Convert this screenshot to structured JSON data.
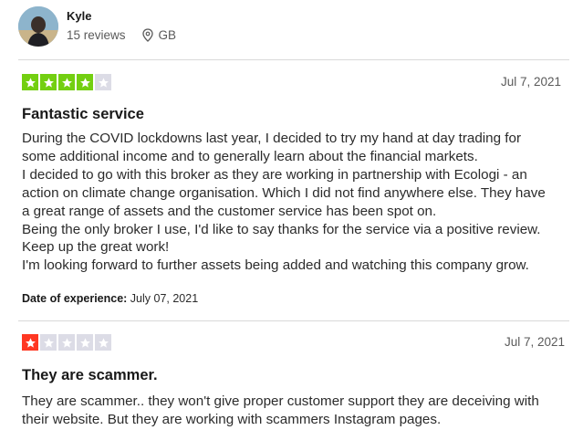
{
  "reviewer": {
    "name": "Kyle",
    "reviews_count": "15 reviews",
    "location": "GB"
  },
  "reviews": [
    {
      "rating": 4,
      "max_rating": 5,
      "star_color": "#73cf11",
      "empty_star_color": "#dcdce6",
      "date": "Jul 7, 2021",
      "title": "Fantastic service",
      "body_lines": [
        "During the COVID lockdowns last year, I decided to try my hand at day trading for",
        "some additional income and to generally learn about the financial markets.",
        "I decided to go with this broker as they are working in partnership with Ecologi - an",
        "action on climate change organisation. Which I did not find anywhere else. They have",
        "a great range of assets and the customer service has been spot on.",
        "Being the only broker I use, I'd like to say thanks for the service via a positive review.",
        "Keep up the great work!",
        "I'm looking forward to further assets being added and watching this company grow."
      ],
      "experience_label": "Date of experience:",
      "experience_date": " July 07, 2021"
    },
    {
      "rating": 1,
      "max_rating": 5,
      "star_color": "#ff3722",
      "empty_star_color": "#dcdce6",
      "date": "Jul 7, 2021",
      "title": "They are scammer.",
      "body_lines": [
        "They are scammer.. they won't give proper customer support they are deceiving with",
        "their website. But they are working with scammers Instagram pages."
      ]
    }
  ]
}
